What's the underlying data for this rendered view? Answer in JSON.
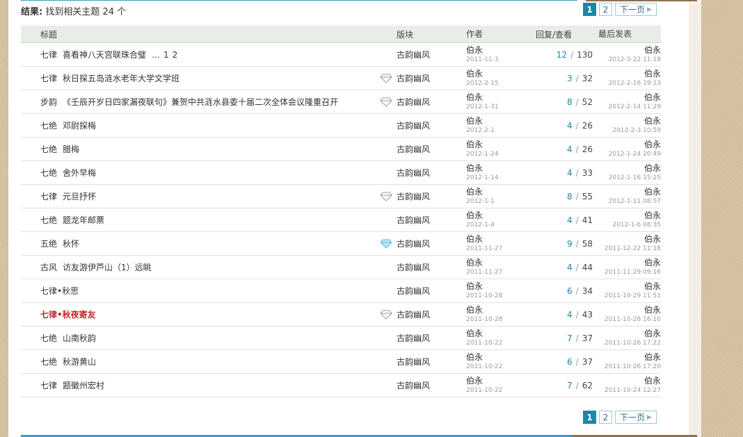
{
  "result": {
    "label": "结果:",
    "text": "找到相关主题 24 个"
  },
  "pager": {
    "pages": [
      "1",
      "2"
    ],
    "current": "1",
    "next_label": "下一页"
  },
  "columns": {
    "title": "标题",
    "forum": "版块",
    "author": "作者",
    "counts": "回复/查看",
    "last": "最后发表"
  },
  "rows": [
    {
      "type": "七律",
      "subject": "喜看神八天宫联珠合璧",
      "pages": [
        "…",
        "1",
        "2"
      ],
      "gem": "none",
      "forum": "古韵幽风",
      "author": "伯永",
      "date": "2011-11-3",
      "replies": "12",
      "views": "130",
      "last_author": "伯永",
      "last_date": "2012-3-22 11:18",
      "highlight": false
    },
    {
      "type": "七律",
      "subject": "秋日探五岛涟水老年大学文学班",
      "pages": [],
      "gem": "outline",
      "forum": "古韵幽风",
      "author": "伯永",
      "date": "2012-2-15",
      "replies": "3",
      "views": "32",
      "last_author": "伯永",
      "last_date": "2012-2-16 19:13",
      "highlight": false
    },
    {
      "type": "步韵",
      "subject": "《壬辰开岁日四家漏夜联句》兼贺中共涟水县委十届二次全体会议隆重召开",
      "pages": [],
      "gem": "outline",
      "forum": "古韵幽风",
      "author": "伯永",
      "date": "2012-1-31",
      "replies": "8",
      "views": "52",
      "last_author": "伯永",
      "last_date": "2012-2-14 11:29",
      "highlight": false
    },
    {
      "type": "七绝",
      "subject": "邓尉探梅",
      "pages": [],
      "gem": "none",
      "forum": "古韵幽风",
      "author": "伯永",
      "date": "2012-2-1",
      "replies": "4",
      "views": "26",
      "last_author": "伯永",
      "last_date": "2012-2-3 10:59",
      "highlight": false
    },
    {
      "type": "七绝",
      "subject": "腊梅",
      "pages": [],
      "gem": "none",
      "forum": "古韵幽风",
      "author": "伯永",
      "date": "2012-1-24",
      "replies": "4",
      "views": "26",
      "last_author": "伯永",
      "last_date": "2012-1-24 20:49",
      "highlight": false
    },
    {
      "type": "七绝",
      "subject": "舍外早梅",
      "pages": [],
      "gem": "none",
      "forum": "古韵幽风",
      "author": "伯永",
      "date": "2012-1-14",
      "replies": "4",
      "views": "33",
      "last_author": "伯永",
      "last_date": "2012-1-16 15:25",
      "highlight": false
    },
    {
      "type": "七律",
      "subject": "元旦抒怀",
      "pages": [],
      "gem": "outline",
      "forum": "古韵幽风",
      "author": "伯永",
      "date": "2012-1-1",
      "replies": "8",
      "views": "55",
      "last_author": "伯永",
      "last_date": "2012-1-11 08:57",
      "highlight": false
    },
    {
      "type": "七绝",
      "subject": "题龙年邮票",
      "pages": [],
      "gem": "none",
      "forum": "古韵幽风",
      "author": "伯永",
      "date": "2012-1-4",
      "replies": "4",
      "views": "41",
      "last_author": "伯永",
      "last_date": "2012-1-6 08:35",
      "highlight": false
    },
    {
      "type": "五绝",
      "subject": "秋怀",
      "pages": [],
      "gem": "blue",
      "forum": "古韵幽风",
      "author": "伯永",
      "date": "2011-11-27",
      "replies": "9",
      "views": "58",
      "last_author": "伯永",
      "last_date": "2011-12-22 11:18",
      "highlight": false
    },
    {
      "type": "古风",
      "subject": "访友游伊芦山（1）远眺",
      "pages": [],
      "gem": "none",
      "forum": "古韵幽风",
      "author": "伯永",
      "date": "2011-11-27",
      "replies": "4",
      "views": "44",
      "last_author": "伯永",
      "last_date": "2011-11-29 09:16",
      "highlight": false
    },
    {
      "type": "七律•秋思",
      "subject": "",
      "pages": [],
      "gem": "none",
      "forum": "古韵幽风",
      "author": "伯永",
      "date": "2011-10-28",
      "replies": "6",
      "views": "34",
      "last_author": "伯永",
      "last_date": "2011-10-29 11:51",
      "highlight": false
    },
    {
      "type": "七律•秋夜寄友",
      "subject": "",
      "pages": [],
      "gem": "outline",
      "forum": "古韵幽风",
      "author": "伯永",
      "date": "2011-10-28",
      "replies": "4",
      "views": "43",
      "last_author": "伯永",
      "last_date": "2011-10-28 16:10",
      "highlight": true
    },
    {
      "type": "七绝",
      "subject": "山南秋韵",
      "pages": [],
      "gem": "none",
      "forum": "古韵幽风",
      "author": "伯永",
      "date": "2011-10-22",
      "replies": "7",
      "views": "37",
      "last_author": "伯永",
      "last_date": "2011-10-26 17:22",
      "highlight": false
    },
    {
      "type": "七绝",
      "subject": "秋游黄山",
      "pages": [],
      "gem": "none",
      "forum": "古韵幽风",
      "author": "伯永",
      "date": "2011-10-22",
      "replies": "6",
      "views": "37",
      "last_author": "伯永",
      "last_date": "2011-10-26 17:20",
      "highlight": false
    },
    {
      "type": "七律",
      "subject": "题徽州宏村",
      "pages": [],
      "gem": "none",
      "forum": "古韵幽风",
      "author": "伯永",
      "date": "2011-10-22",
      "replies": "7",
      "views": "62",
      "last_author": "伯永",
      "last_date": "2011-10-24 12:27",
      "highlight": false
    }
  ],
  "colors": {
    "accent": "#178aa6",
    "reply": "#1c87a8",
    "highlight": "#c0282d",
    "gem_blue": "#5ab9dc",
    "gem_outline": "#999999"
  }
}
